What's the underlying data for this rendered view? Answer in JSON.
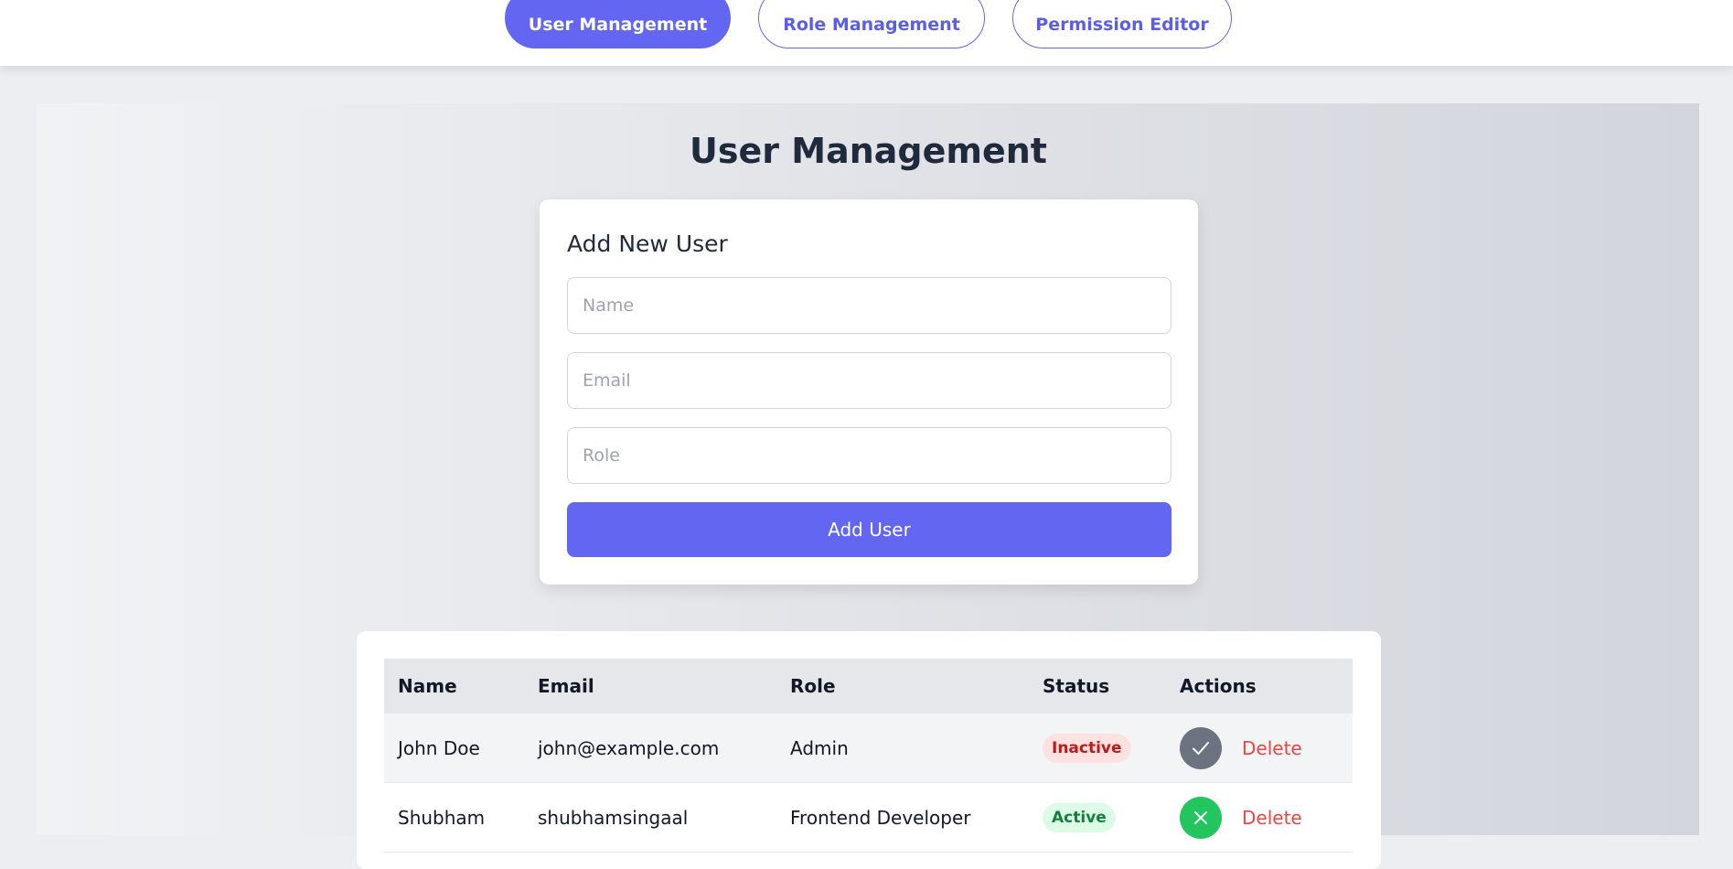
{
  "nav": {
    "tabs": [
      {
        "label": "User Management",
        "active": true
      },
      {
        "label": "Role Management",
        "active": false
      },
      {
        "label": "Permission Editor",
        "active": false
      }
    ]
  },
  "page": {
    "title": "User Management"
  },
  "form": {
    "heading": "Add New User",
    "name_placeholder": "Name",
    "email_placeholder": "Email",
    "role_placeholder": "Role",
    "submit_label": "Add User"
  },
  "table": {
    "columns": [
      "Name",
      "Email",
      "Role",
      "Status",
      "Actions"
    ],
    "rows": [
      {
        "name": "John Doe",
        "email": "john@example.com",
        "role": "Admin",
        "status": "Inactive",
        "toggle_icon": "check-icon",
        "delete_label": "Delete"
      },
      {
        "name": "Shubham",
        "email": "shubhamsingaal",
        "role": "Frontend Developer",
        "status": "Active",
        "toggle_icon": "x-icon",
        "delete_label": "Delete"
      }
    ]
  },
  "colors": {
    "accent": "#6366f1",
    "inactive_badge": "#fee2e2",
    "active_badge": "#dcfce7",
    "delete_text": "#ef4444"
  }
}
